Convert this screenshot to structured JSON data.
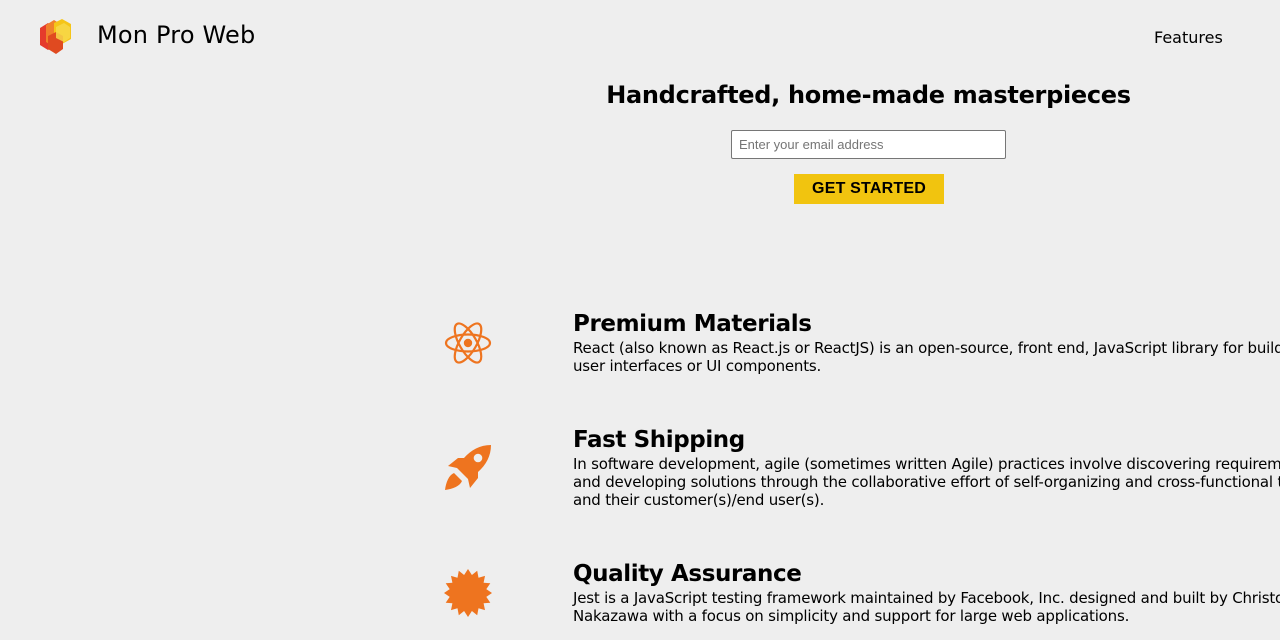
{
  "header": {
    "brand": "Mon Pro Web",
    "nav": {
      "features_label": "Features"
    },
    "logo_colors": {
      "red": "#e53b2c",
      "orange": "#f0812a",
      "yellow": "#f5c518"
    }
  },
  "hero": {
    "title": "Handcrafted, home-made masterpieces",
    "email_placeholder": "Enter your email address",
    "email_value": "",
    "cta_label": "GET STARTED",
    "cta_color": "#f1c40f"
  },
  "features": [
    {
      "icon": "react-atom-icon",
      "title": "Premium Materials",
      "text": "React (also known as React.js or ReactJS) is an open-source, front end, JavaScript library for building user interfaces or UI components."
    },
    {
      "icon": "rocket-icon",
      "title": "Fast Shipping",
      "text": "In software development, agile (sometimes written Agile) practices involve discovering requirements and developing solutions through the collaborative effort of self-organizing and cross-functional teams and their customer(s)/end user(s)."
    },
    {
      "icon": "badge-icon",
      "title": "Quality Assurance",
      "text": "Jest is a JavaScript testing framework maintained by Facebook, Inc. designed and built by Christoph Nakazawa with a focus on simplicity and support for large web applications."
    }
  ],
  "icon_color": "#ee741f"
}
